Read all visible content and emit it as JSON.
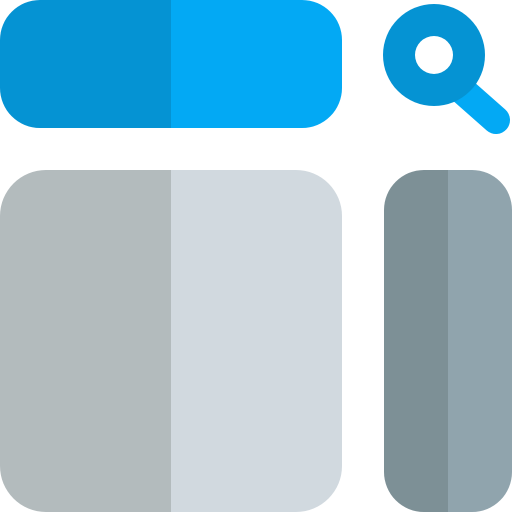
{
  "icon": {
    "name": "search-layout-icon",
    "colors": {
      "search_bar_left": "#0593D3",
      "search_bar_right": "#03A9F4",
      "magnifier_ring": "#0593D3",
      "magnifier_handle": "#03A9F4",
      "magnifier_center": "#ffffff",
      "content_panel_left": "#B3BBBD",
      "content_panel_right": "#D1D9DF",
      "sidebar_left": "#7D9096",
      "sidebar_right": "#90A4AD"
    }
  }
}
